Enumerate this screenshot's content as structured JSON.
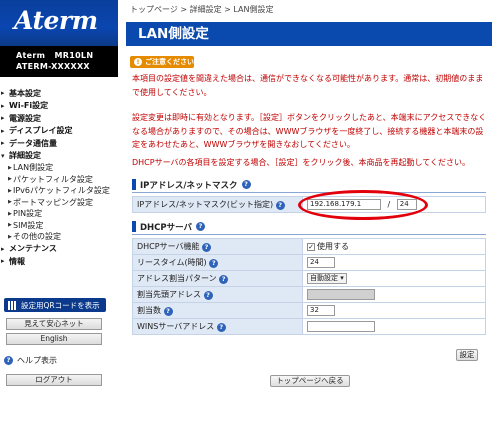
{
  "sidebar": {
    "logo": "Aterm",
    "model_line1": "Aterm   MR10LN",
    "model_line2": "ATERM-XXXXXX",
    "sections": [
      {
        "label": "基本設定"
      },
      {
        "label": "Wi-Fi設定"
      },
      {
        "label": "電源設定"
      },
      {
        "label": "ディスプレイ設定"
      },
      {
        "label": "データ通信量"
      },
      {
        "label": "詳細設定",
        "sub": [
          "LAN側設定",
          "パケットフィルタ設定",
          "IPv6パケットフィルタ設定",
          "ポートマッピング設定",
          "PIN設定",
          "SIM設定",
          "その他の設定"
        ]
      },
      {
        "label": "メンテナンス"
      },
      {
        "label": "情報"
      }
    ],
    "qr_button": "設定用QRコードを表示",
    "mimamori_button": "見えて安心ネット",
    "english_button": "English",
    "help_label": "ヘルプ表示",
    "logout_button": "ログアウト"
  },
  "main": {
    "breadcrumb": "トップページ > 詳細設定 > LAN側設定",
    "title": "LAN側設定",
    "notice_label": "ご注意ください",
    "warning1": "本項目の設定値を間違えた場合は、通信ができなくなる可能性があります。通常は、初期値のままで使用してください。",
    "warning2": "設定変更は即時に有効となります。［設定］ボタンをクリックしたあと、本端末にアクセスできなくなる場合がありますので、その場合は、WWWブラウザを一度終了し、接続する機器と本端末の設定をあわせたあと、WWWブラウザを開きなおしてください。",
    "warning3": "DHCPサーバの各項目を設定する場合、［設定］をクリック後、本商品を再起動してください。",
    "ip_section": {
      "title": "IPアドレス/ネットマスク",
      "row_label": "IPアドレス/ネットマスク(ビット指定)",
      "ip_value": "192.168.179.1",
      "separator": "/",
      "mask_value": "24"
    },
    "dhcp_section": {
      "title": "DHCPサーバ",
      "rows": {
        "dhcp_enable_label": "DHCPサーバ機能",
        "dhcp_enable_value": "使用する",
        "lease_label": "リースタイム(時間)",
        "lease_value": "24",
        "pattern_label": "アドレス割当パターン",
        "pattern_value": "自動設定",
        "start_label": "割当先頭アドレス",
        "start_value": "",
        "count_label": "割当数",
        "count_value": "32",
        "wins_label": "WINSサーバアドレス",
        "wins_value": ""
      }
    },
    "set_button": "設定",
    "back_button": "トップページへ戻る"
  },
  "colors": {
    "brand_blue": "#0a49ad",
    "warning_red": "#c00000",
    "notice_orange": "#e68a00",
    "highlight_oval": "#e2000a"
  }
}
